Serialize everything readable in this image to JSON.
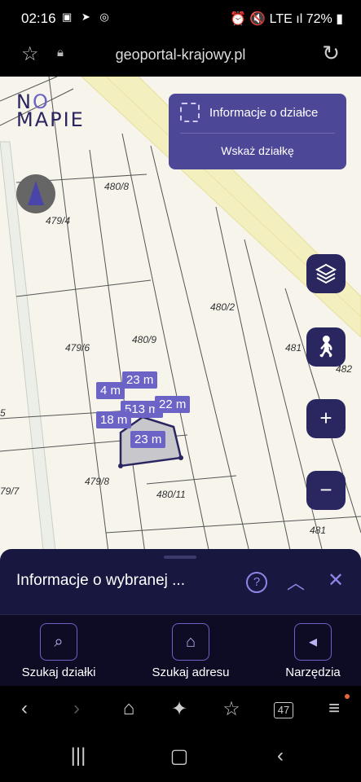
{
  "status_bar": {
    "time": "02:16",
    "left_icons": "▣ ➤ ◎",
    "right_text": "⏰ 🔇 LTE ıl 72% ▮",
    "battery": "72%"
  },
  "browser": {
    "url": "geoportal-krajowy.pl"
  },
  "logo": {
    "line1_a": "N",
    "line1_b": "O",
    "line2": "MAPIE"
  },
  "info_panel": {
    "title": "Informacje o działce",
    "action": "Wskaż działkę"
  },
  "map": {
    "parcels": [
      "480/8",
      "479/4",
      "480/2",
      "480/9",
      "479/6",
      "481",
      "482",
      "5",
      "79/7",
      "479/8",
      "480/11",
      "481"
    ],
    "measurements": [
      "4 m",
      "23 m",
      "513 m",
      "22 m",
      "18 m",
      "23 m"
    ]
  },
  "map_buttons": {
    "layers": "layers-icon",
    "walk": "walk-icon",
    "zoom_in": "+",
    "zoom_out": "−"
  },
  "sheet": {
    "title": "Informacje o wybranej ...",
    "help": "?",
    "up": "︿",
    "close": "✕"
  },
  "tools": [
    {
      "label": "Szukaj działki",
      "icon": "map-search-icon"
    },
    {
      "label": "Szukaj adresu",
      "icon": "home-search-icon"
    },
    {
      "label": "Narzędzia",
      "icon": "tools-icon"
    }
  ],
  "tab_count": "47",
  "colors": {
    "accent": "#6b63c6",
    "panel": "#4c4797",
    "dark": "#181740"
  }
}
